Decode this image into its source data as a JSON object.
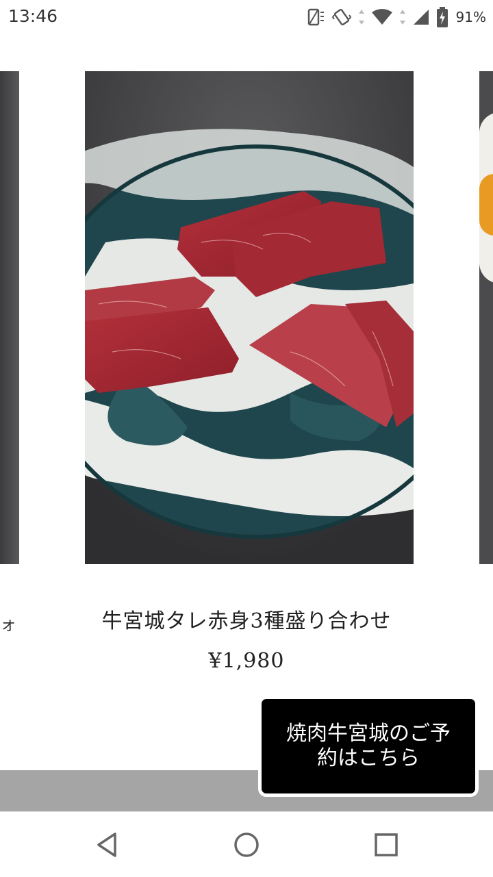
{
  "status_bar": {
    "time": "13:46",
    "battery": "91%",
    "icons": [
      "rotate-icon",
      "vibrate-icon",
      "wifi-icon",
      "signal-icon",
      "battery-icon"
    ]
  },
  "carousel": {
    "left_image": "dark-photo-fragment",
    "main_image": "plate-of-raw-beef",
    "right_image": "egg-photo-fragment"
  },
  "product": {
    "prev_caption_fragment": "ォ",
    "title": "牛宮城タレ赤身3種盛り合わせ",
    "price": "¥1,980"
  },
  "reserve": {
    "label": "焼肉牛宮城のご予約はこちら"
  },
  "nav": {
    "icons": [
      "back-icon",
      "home-icon",
      "recents-icon"
    ]
  },
  "colors": {
    "button_bg": "#000000",
    "band": "#a5a5a5",
    "plate_teal": "#1f4a50",
    "meat": "#a42b35"
  }
}
